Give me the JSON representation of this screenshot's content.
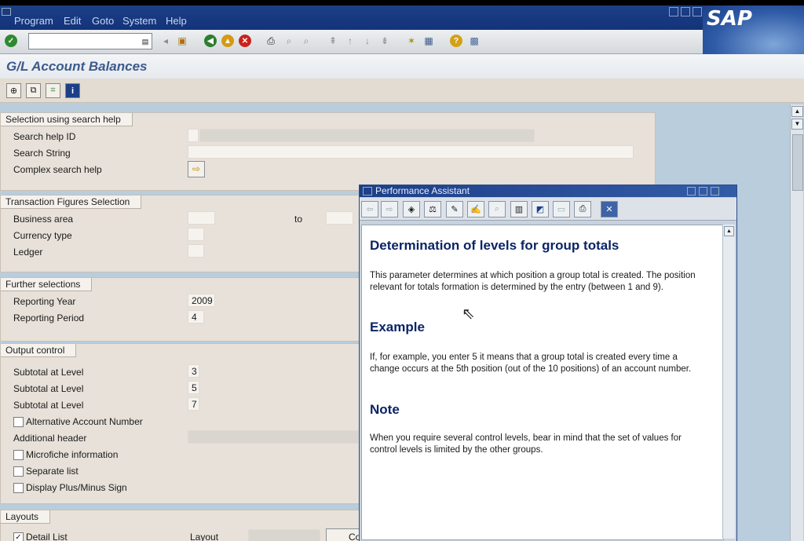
{
  "menu": [
    "Program",
    "Edit",
    "Goto",
    "System",
    "Help"
  ],
  "brand": "SAP",
  "toolbar": {
    "command_value": ""
  },
  "title": "G/L Account Balances",
  "sections": {
    "search_help": {
      "header": "Selection using search help",
      "search_help_id_label": "Search help ID",
      "search_string_label": "Search String",
      "complex_label": "Complex search help"
    },
    "transaction": {
      "header": "Transaction Figures Selection",
      "business_area_label": "Business area",
      "to_label": "to",
      "currency_label": "Currency type",
      "ledger_label": "Ledger"
    },
    "further": {
      "header": "Further selections",
      "year_label": "Reporting Year",
      "year_value": "2009",
      "period_label": "Reporting Period",
      "period_value": "4"
    },
    "output": {
      "header": "Output control",
      "subtotal_label": "Subtotal at Level",
      "subtotal_values": [
        "3",
        "5",
        "7"
      ],
      "alt_account_label": "Alternative Account Number",
      "additional_header_label": "Additional header",
      "microfiche_label": "Microfiche information",
      "separate_list_label": "Separate list",
      "plus_minus_label": "Display Plus/Minus Sign"
    },
    "layouts": {
      "header": "Layouts",
      "detail_list_label": "Detail List",
      "detail_list_checked": true,
      "layout_label": "Layout",
      "button_partial": "Co"
    }
  },
  "assistant": {
    "title": "Performance Assistant",
    "heading1": "Determination of levels for group totals",
    "para1": "This parameter determines at which position a group total is created. The position relevant for totals formation is determined by the entry (between 1 and 9).",
    "heading2": "Example",
    "para2": "If, for example, you enter 5 it means that a group total is created every time a change occurs at the 5th position (out of the 10 positions) of an account number.",
    "heading3": "Note",
    "para3": "When you require several control levels, bear in mind that the set of values for control levels is limited by the other groups."
  },
  "colors": {
    "menubar": "#1c3f86",
    "group_bg": "#e7e1d9",
    "heading_blue": "#0c2466",
    "background": "#b9cddc"
  }
}
